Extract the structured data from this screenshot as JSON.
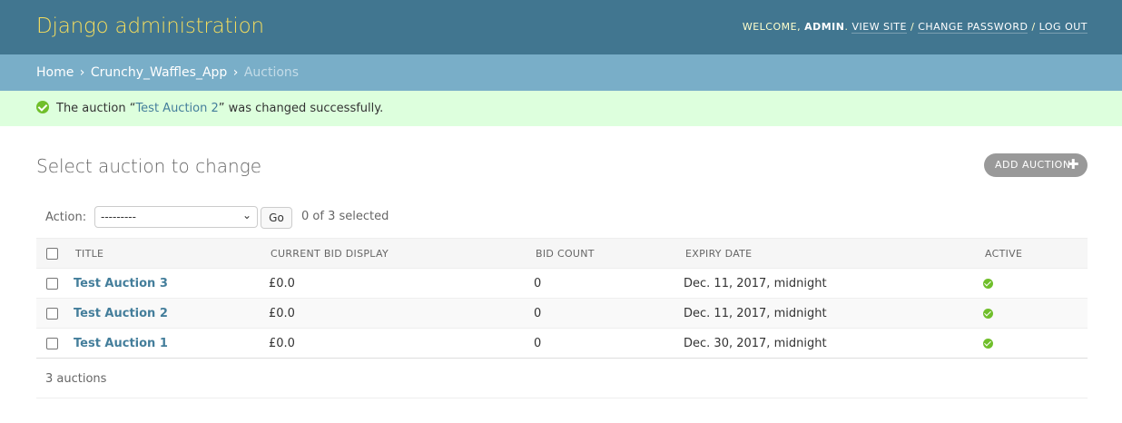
{
  "header": {
    "site_name": "Django administration",
    "welcome": "Welcome,",
    "username": "admin",
    "view_site": "View site",
    "change_password": "Change password",
    "log_out": "Log out"
  },
  "breadcrumbs": {
    "home": "Home",
    "app": "Crunchy_Waffles_App",
    "current": "Auctions"
  },
  "message": {
    "prefix": "The auction “",
    "link": "Test Auction 2",
    "suffix": "” was changed successfully."
  },
  "page": {
    "title": "Select auction to change",
    "add_button": "Add auction"
  },
  "actions": {
    "label": "Action:",
    "selected_option": "---------",
    "go_button": "Go",
    "counter": "0 of 3 selected"
  },
  "table": {
    "columns": [
      "Title",
      "Current bid display",
      "Bid count",
      "Expiry date",
      "Active"
    ],
    "rows": [
      {
        "title": "Test Auction 3",
        "current_bid": "£0.0",
        "bid_count": "0",
        "expiry": "Dec. 11, 2017, midnight",
        "active": true
      },
      {
        "title": "Test Auction 2",
        "current_bid": "£0.0",
        "bid_count": "0",
        "expiry": "Dec. 11, 2017, midnight",
        "active": true
      },
      {
        "title": "Test Auction 1",
        "current_bid": "£0.0",
        "bid_count": "0",
        "expiry": "Dec. 30, 2017, midnight",
        "active": true
      }
    ]
  },
  "paginator": {
    "count_label": "3 auctions"
  },
  "colors": {
    "header_bg": "#417690",
    "breadcrumbs_bg": "#79aec8",
    "success_bg": "#dddddd",
    "link": "#447e9b",
    "active_icon": "#70bf2b"
  }
}
